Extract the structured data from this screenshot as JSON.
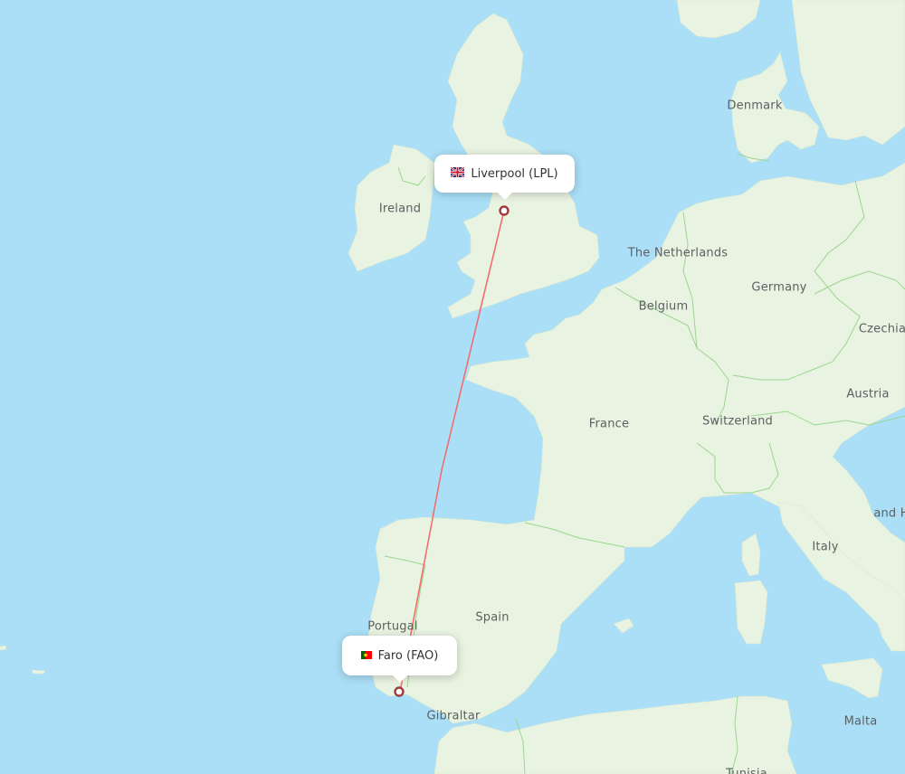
{
  "map": {
    "colors": {
      "water": "#aadff7",
      "land": "#e9f3e1",
      "border": "#9bd68f",
      "route": "#f06e6e",
      "pin": "#a03a3a",
      "label": "#5d5f60"
    },
    "country_labels": [
      {
        "name": "Denmark"
      },
      {
        "name": "Ireland"
      },
      {
        "name": "The Netherlands"
      },
      {
        "name": "Germany"
      },
      {
        "name": "Belgium"
      },
      {
        "name": "Czechia"
      },
      {
        "name": "Austria"
      },
      {
        "name": "France"
      },
      {
        "name": "Switzerland"
      },
      {
        "name": "and H"
      },
      {
        "name": "Italy"
      },
      {
        "name": "Portugal"
      },
      {
        "name": "Spain"
      },
      {
        "name": "Gibraltar"
      },
      {
        "name": "Malta"
      },
      {
        "name": "Tunisia"
      }
    ],
    "origin": {
      "label": "Liverpool (LPL)",
      "flag": "uk-flag-icon",
      "country": "United Kingdom"
    },
    "destination": {
      "label": "Faro (FAO)",
      "flag": "portugal-flag-icon",
      "country": "Portugal"
    }
  }
}
